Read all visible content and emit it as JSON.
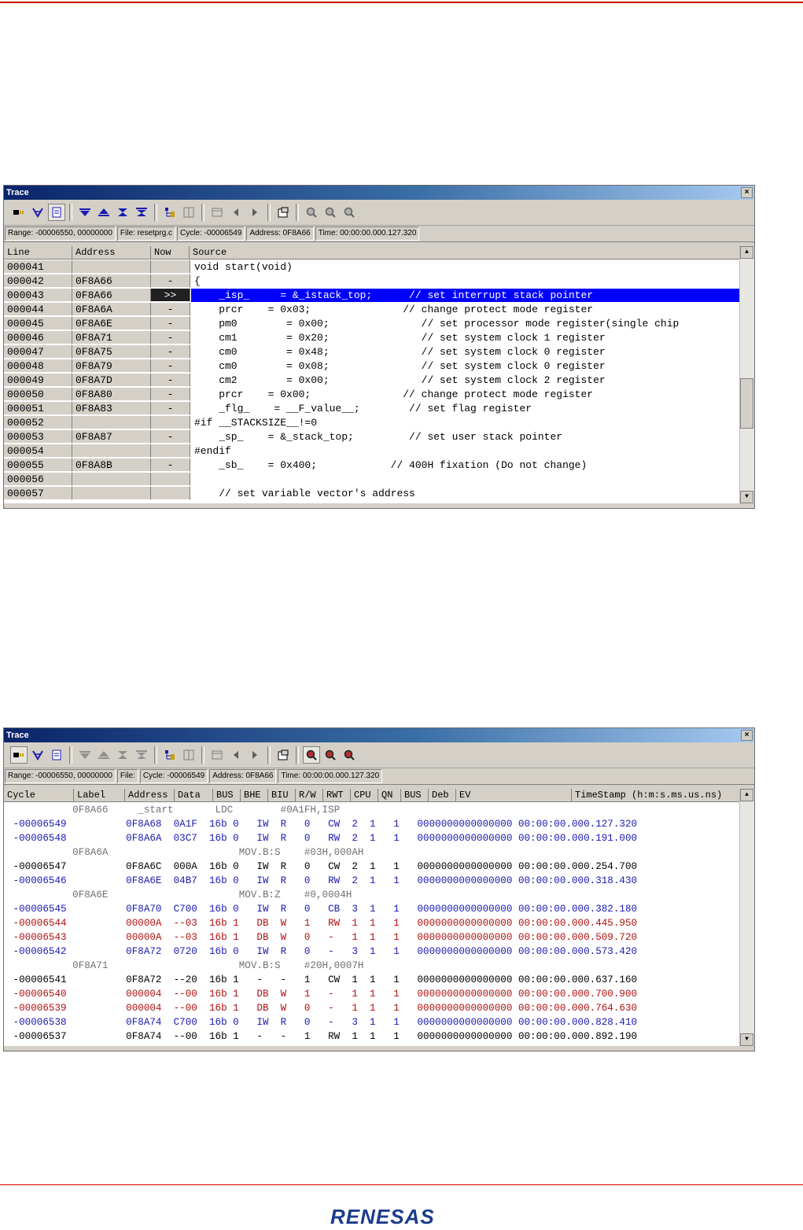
{
  "source_trace": {
    "title": "Trace",
    "close": "×",
    "status": {
      "range": "Range: -00006550, 00000000",
      "file": "File: resetprg.c",
      "cycle": "Cycle: -00006549",
      "address": "Address: 0F8A66",
      "time": "Time: 00:00:00.000.127.320"
    },
    "columns": [
      "Line",
      "Address",
      "Now",
      "Source"
    ],
    "rows": [
      {
        "line": "000041",
        "address": "",
        "now": "",
        "source": "void start(void)"
      },
      {
        "line": "000042",
        "address": "0F8A66",
        "now": "-",
        "source": "{"
      },
      {
        "line": "000043",
        "address": "0F8A66",
        "now": ">>",
        "source": "    _isp_     = &_istack_top;      // set interrupt stack pointer"
      },
      {
        "line": "000044",
        "address": "0F8A6A",
        "now": "-",
        "source": "    prcr    = 0x03;               // change protect mode register"
      },
      {
        "line": "000045",
        "address": "0F8A6E",
        "now": "-",
        "source": "    pm0        = 0x00;               // set processor mode register(single chip"
      },
      {
        "line": "000046",
        "address": "0F8A71",
        "now": "-",
        "source": "    cm1        = 0x20;               // set system clock 1 register"
      },
      {
        "line": "000047",
        "address": "0F8A75",
        "now": "-",
        "source": "    cm0        = 0x48;               // set system clock 0 register"
      },
      {
        "line": "000048",
        "address": "0F8A79",
        "now": "-",
        "source": "    cm0        = 0x08;               // set system clock 0 register"
      },
      {
        "line": "000049",
        "address": "0F8A7D",
        "now": "-",
        "source": "    cm2        = 0x00;               // set system clock 2 register"
      },
      {
        "line": "000050",
        "address": "0F8A80",
        "now": "-",
        "source": "    prcr    = 0x00;               // change protect mode register"
      },
      {
        "line": "000051",
        "address": "0F8A83",
        "now": "-",
        "source": "    _flg_    = __F_value__;        // set flag register"
      },
      {
        "line": "000052",
        "address": "",
        "now": "",
        "source": "#if __STACKSIZE__!=0"
      },
      {
        "line": "000053",
        "address": "0F8A87",
        "now": "-",
        "source": "    _sp_    = &_stack_top;         // set user stack pointer"
      },
      {
        "line": "000054",
        "address": "",
        "now": "",
        "source": "#endif"
      },
      {
        "line": "000055",
        "address": "0F8A8B",
        "now": "-",
        "source": "    _sb_    = 0x400;            // 400H fixation (Do not change)"
      },
      {
        "line": "000056",
        "address": "",
        "now": "",
        "source": ""
      },
      {
        "line": "000057",
        "address": "",
        "now": "",
        "source": "    // set variable vector's address"
      }
    ]
  },
  "bus_trace": {
    "title": "Trace",
    "close": "×",
    "status": {
      "range": "Range: -00006550, 00000000",
      "file": "File:",
      "cycle": "Cycle: -00006549",
      "address": "Address: 0F8A66",
      "time": "Time: 00:00:00.000.127.320"
    },
    "columns": [
      "Cycle",
      "Label",
      "Address",
      "Data",
      "BUS",
      "BHE",
      "BIU",
      "R/W",
      "RWT",
      "CPU",
      "QN",
      "BUS",
      "Deb",
      "EV",
      "TimeStamp (h:m:s.ms.us.ns)"
    ],
    "rows": [
      {
        "kind": "asm",
        "text": "           0F8A66     _start       LDC        #0A1FH,ISP"
      },
      {
        "kind": "blue",
        "text": " -00006549          0F8A68  0A1F  16b 0   IW  R   0   CW  2  1   1   0000000000000000 00:00:00.000.127.320"
      },
      {
        "kind": "blue",
        "text": " -00006548          0F8A6A  03C7  16b 0   IW  R   0   RW  2  1   1   0000000000000000 00:00:00.000.191.000"
      },
      {
        "kind": "asm",
        "text": "           0F8A6A                      MOV.B:S    #03H,000AH"
      },
      {
        "kind": "black",
        "text": " -00006547          0F8A6C  000A  16b 0   IW  R   0   CW  2  1   1   0000000000000000 00:00:00.000.254.700"
      },
      {
        "kind": "blue",
        "text": " -00006546          0F8A6E  04B7  16b 0   IW  R   0   RW  2  1   1   0000000000000000 00:00:00.000.318.430"
      },
      {
        "kind": "asm",
        "text": "           0F8A6E                      MOV.B:Z    #0,0004H"
      },
      {
        "kind": "blue",
        "text": " -00006545          0F8A70  C700  16b 0   IW  R   0   CB  3  1   1   0000000000000000 00:00:00.000.382.180"
      },
      {
        "kind": "red",
        "text": " -00006544          00000A  --03  16b 1   DB  W   1   RW  1  1   1   0000000000000000 00:00:00.000.445.950"
      },
      {
        "kind": "red",
        "text": " -00006543          00000A  --03  16b 1   DB  W   0   -   1  1   1   0000000000000000 00:00:00.000.509.720"
      },
      {
        "kind": "blue",
        "text": " -00006542          0F8A72  0720  16b 0   IW  R   0   -   3  1   1   0000000000000000 00:00:00.000.573.420"
      },
      {
        "kind": "asm",
        "text": "           0F8A71                      MOV.B:S    #20H,0007H"
      },
      {
        "kind": "black",
        "text": " -00006541          0F8A72  --20  16b 1   -   -   1   CW  1  1   1   0000000000000000 00:00:00.000.637.160"
      },
      {
        "kind": "red",
        "text": " -00006540          000004  --00  16b 1   DB  W   1   -   1  1   1   0000000000000000 00:00:00.000.700.900"
      },
      {
        "kind": "red",
        "text": " -00006539          000004  --00  16b 1   DB  W   0   -   1  1   1   0000000000000000 00:00:00.000.764.630"
      },
      {
        "kind": "blue",
        "text": " -00006538          0F8A74  C700  16b 0   IW  R   0   -   3  1   1   0000000000000000 00:00:00.000.828.410"
      },
      {
        "kind": "black",
        "text": " -00006537          0F8A74  --00  16b 1   -   -   1   RW  1  1   1   0000000000000000 00:00:00.000.892.190"
      }
    ]
  },
  "toolbar_icons": [
    "cursor-icon",
    "filter-icon",
    "document-icon",
    "step-down-icon",
    "step-up-icon",
    "go-bottom-icon",
    "go-top-icon",
    "tree-icon",
    "split-icon",
    "window-icon",
    "left-arrow-icon",
    "right-arrow-icon",
    "properties-icon",
    "zoom-icon",
    "zoom-in-icon",
    "zoom-out-icon"
  ],
  "footer": {
    "logo": "RENESAS"
  },
  "colors": {
    "accent": "#cc0000",
    "highlight": "#0000ff",
    "title_bar": "#0a246a"
  }
}
